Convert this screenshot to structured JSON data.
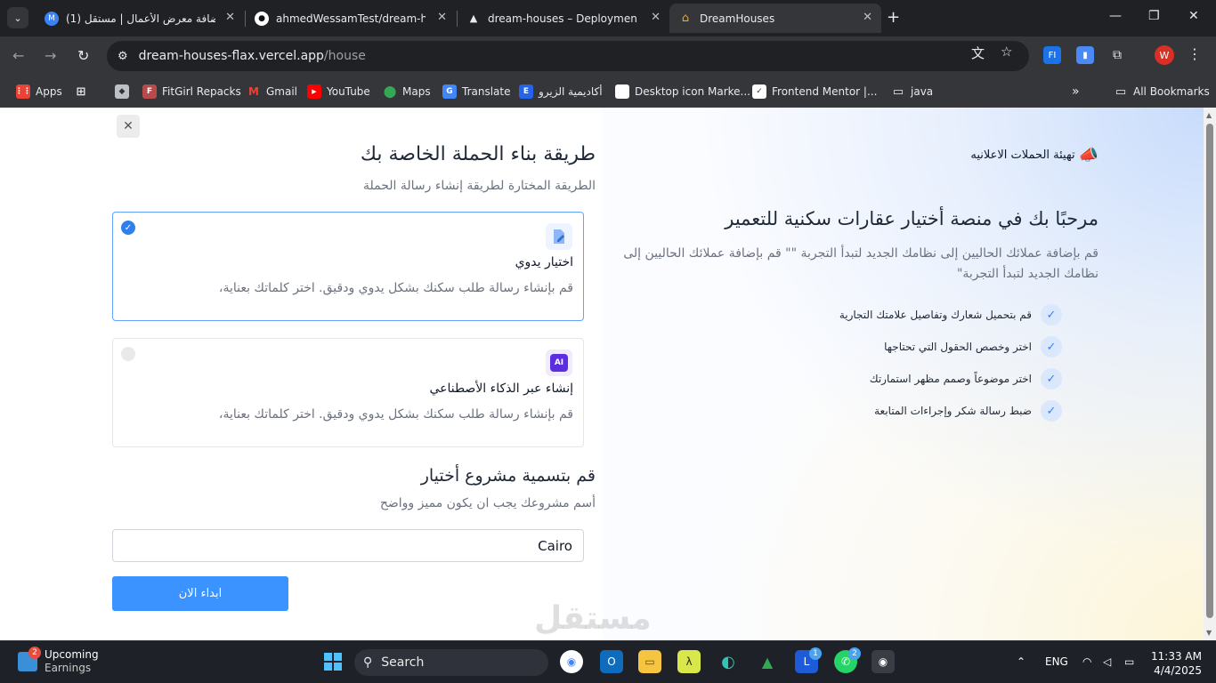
{
  "browser": {
    "tabs": [
      {
        "title": "(1) إضافة معرض الأعمال | مستقل",
        "favicon": "M",
        "favicon_color": "#3b82f6"
      },
      {
        "title": "ahmedWessamTest/dream-hou",
        "favicon": "●",
        "favicon_color": "#ffffff"
      },
      {
        "title": "dream-houses – Deployment O",
        "favicon": "▲",
        "favicon_color": "#202124"
      },
      {
        "title": "DreamHouses",
        "favicon": "⌂",
        "favicon_color": "#f5a623"
      }
    ],
    "url_host": "dream-houses-flax.vercel.app",
    "url_path": "/house",
    "bookmarks": [
      {
        "label": "Apps",
        "icon": "apps-grid-icon",
        "color": "#ea4335"
      },
      {
        "label": "",
        "icon": "tab-groups-icon",
        "color": "#5f6368"
      },
      {
        "label": "",
        "icon": "roblox-icon",
        "color": "#9aa0a6"
      },
      {
        "label": "FitGirl Repacks",
        "icon": "fitgirl-icon",
        "color": "#b74b4b"
      },
      {
        "label": "Gmail",
        "icon": "gmail-icon",
        "color": "#ea4335"
      },
      {
        "label": "YouTube",
        "icon": "youtube-icon",
        "color": "#ff0000"
      },
      {
        "label": "Maps",
        "icon": "maps-icon",
        "color": "#34a853"
      },
      {
        "label": "Translate",
        "icon": "translate-icon",
        "color": "#4285f4"
      },
      {
        "label": "أكاديمية الزيرو",
        "icon": "zero-academy-icon",
        "color": "#2563eb"
      },
      {
        "label": "Desktop icon Marke...",
        "icon": "page-icon",
        "color": "#ffffff"
      },
      {
        "label": "Frontend Mentor |...",
        "icon": "frontend-mentor-icon",
        "color": "#ffffff"
      },
      {
        "label": "java",
        "icon": "folder-icon",
        "color": "#9aa0a6"
      }
    ],
    "all_bookmarks": "All Bookmarks",
    "profile_letter": "W"
  },
  "form": {
    "title": "طريقة بناء الحملة الخاصة بك",
    "subtitle": "الطريقة المختارة لطريقة إنشاء رسالة الحملة",
    "options": [
      {
        "title": "اختيار يدوي",
        "desc": "قم بإنشاء رسالة طلب سكنك بشكل يدوي ودقيق. اختر كلماتك بعناية،",
        "selected": true
      },
      {
        "title": "إنشاء عبر الذكاء الأصطناعي",
        "desc": "قم بإنشاء رسالة طلب سكنك بشكل يدوي ودقيق. اختر كلماتك بعناية،",
        "selected": false,
        "icon_text": "AI"
      }
    ],
    "name_title": "قم بتسمية مشروع أختيار",
    "name_subtitle": "أسم مشروعك يجب ان يكون مميز وواضح",
    "name_value": "Cairo",
    "start_label": "ابداء الان"
  },
  "intro": {
    "badge": "تهيئة الحملات الاعلانيه",
    "title": "مرحبًا بك في منصة أختيار عقارات سكنية للتعمير",
    "desc": "قم بإضافة عملائك الحاليين إلى نظامك الجديد لتبدأ التجربة \"\" قم بإضافة عملائك الحاليين إلى نظامك الجديد لتبدأ التجربة\"",
    "features": [
      "قم بتحميل شعارك وتفاصيل علامتك التجارية",
      "اختر وخصص الحقول التي تحتاجها",
      "اختر موضوعاً وصمم مظهر استمارتك",
      "ضبط رسالة شكر وإجراءات المتابعة"
    ]
  },
  "watermark": "مستقل",
  "taskbar": {
    "weather_title": "Upcoming",
    "weather_sub": "Earnings",
    "weather_badge": "2",
    "search": "Search",
    "lang": "ENG",
    "time": "11:33 AM",
    "date": "4/4/2025",
    "badge_l": "1",
    "badge_wa": "2"
  }
}
